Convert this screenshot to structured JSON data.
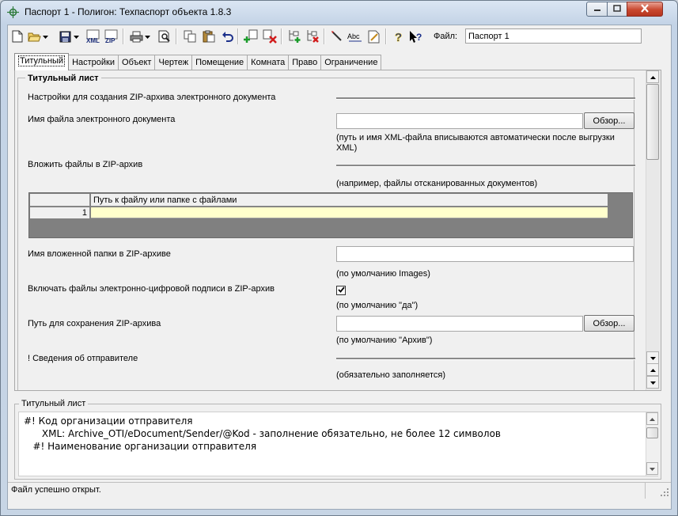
{
  "window": {
    "title": "Паспорт 1 - Полигон: Техпаспорт объекта 1.8.3",
    "minimize": "minimize",
    "maximize": "maximize",
    "close": "close"
  },
  "toolbar": {
    "buttons": [
      {
        "icon": "new-document-icon"
      },
      {
        "icon": "open-folder-icon"
      },
      {
        "icon": "save-disk-icon"
      },
      {
        "icon": "export-xml-icon",
        "text": "XML"
      },
      {
        "icon": "export-zip-icon",
        "text": "ZIP"
      },
      {
        "icon": "printer-icon"
      },
      {
        "icon": "print-preview-icon"
      },
      {
        "icon": "copy-icon"
      },
      {
        "icon": "paste-icon"
      },
      {
        "icon": "undo-icon"
      },
      {
        "icon": "add-object-icon"
      },
      {
        "icon": "delete-object-icon"
      },
      {
        "icon": "add-tree-node-icon"
      },
      {
        "icon": "delete-tree-node-icon"
      },
      {
        "icon": "pen-tool-icon"
      },
      {
        "icon": "spell-check-icon",
        "text": "Abc"
      },
      {
        "icon": "edit-note-icon"
      },
      {
        "icon": "help-icon"
      },
      {
        "icon": "context-help-icon"
      }
    ],
    "file_label": "Файл:",
    "file_value": "Паспорт 1"
  },
  "tabs": [
    {
      "label": "Титульный",
      "active": true
    },
    {
      "label": "Настройки"
    },
    {
      "label": "Объект"
    },
    {
      "label": "Чертеж"
    },
    {
      "label": "Помещение"
    },
    {
      "label": "Комната"
    },
    {
      "label": "Право"
    },
    {
      "label": "Ограничение"
    }
  ],
  "form": {
    "group_title": "Титульный лист",
    "zip_settings_label": "Настройки для создания ZIP-архива электронного документа",
    "doc_filename_label": "Имя файла электронного документа",
    "doc_filename_value": "",
    "doc_filename_hint": "(путь и имя XML-файла вписываются автоматически после выгрузки XML)",
    "browse_label": "Обзор...",
    "attach_files_label": "Вложить файлы в ZIP-архив",
    "attach_files_hint": "(например, файлы отсканированных документов)",
    "grid": {
      "header": "Путь к файлу или папке с файлами",
      "rows": [
        {
          "num": "1",
          "path": ""
        }
      ]
    },
    "nested_folder_label": "Имя вложенной папки в ZIP-архиве",
    "nested_folder_value": "",
    "nested_folder_hint": "(по умолчанию Images)",
    "include_sig_label": "Включать файлы электронно-цифровой подписи в ZIP-архив",
    "include_sig_checked": true,
    "include_sig_hint": "(по умолчанию \"да\")",
    "save_path_label": "Путь для сохранения ZIP-архива",
    "save_path_value": "",
    "save_path_hint": "(по умолчанию \"Архив\")",
    "sender_label": "! Сведения об отправителе",
    "sender_hint": "(обязательно заполняется)"
  },
  "description": {
    "legend": "Титульный лист",
    "lines": [
      "#! Код организации отправителя",
      "      XML: Archive_OTI/eDocument/Sender/@Kod - заполнение обязательно, не более 12 символов",
      "",
      "   #! Наименование организации отправителя"
    ]
  },
  "status": {
    "text": "Файл успешно открыт."
  }
}
